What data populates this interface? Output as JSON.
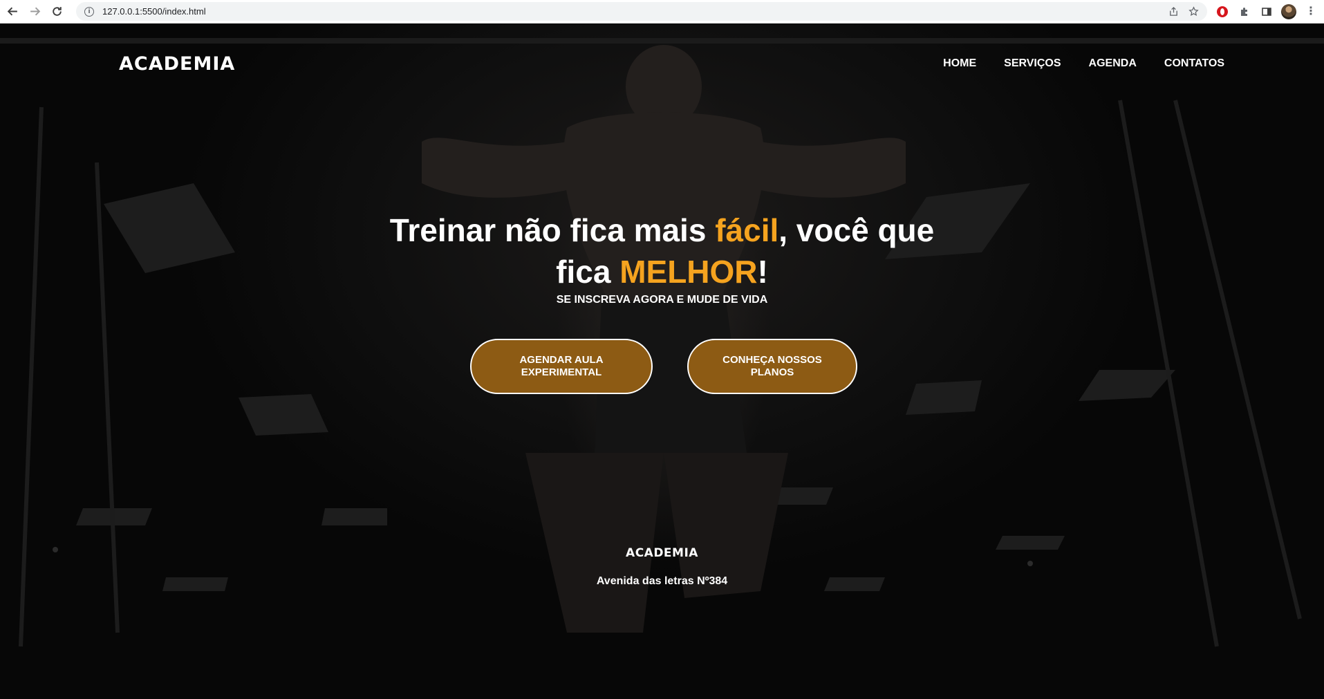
{
  "browser": {
    "url": "127.0.0.1:5500/index.html"
  },
  "icons": {
    "back": "arrow-left-icon",
    "forward": "arrow-right-icon",
    "reload": "reload-icon",
    "info": "info-icon",
    "share": "share-icon",
    "bookmark": "star-icon",
    "opera": "opera-extension-icon",
    "extensions": "puzzle-icon",
    "sidepanel": "side-panel-icon",
    "profile": "avatar",
    "menu": "kebab-menu-icon"
  },
  "header": {
    "logo": "ACADEMIA",
    "nav": [
      "HOME",
      "SERVIÇOS",
      "AGENDA",
      "CONTATOS"
    ]
  },
  "hero": {
    "title_part1": "Treinar não fica mais ",
    "title_accent1": "fácil",
    "title_part2": ", você que fica ",
    "title_accent2": "MELHOR",
    "title_part3": "!",
    "subtitle": "SE INSCREVA AGORA E MUDE DE VIDA"
  },
  "cta": {
    "schedule_label": "AGENDAR AULA EXPERIMENTAL",
    "plans_label": "CONHEÇA NOSSOS PLANOS"
  },
  "footer": {
    "logo": "ACADEMIA",
    "address": "Avenida das letras Nº384"
  },
  "colors": {
    "accent": "#f5a31f",
    "button_bg": "#8d5b14",
    "background": "#0a0a0a",
    "text": "#ffffff"
  }
}
